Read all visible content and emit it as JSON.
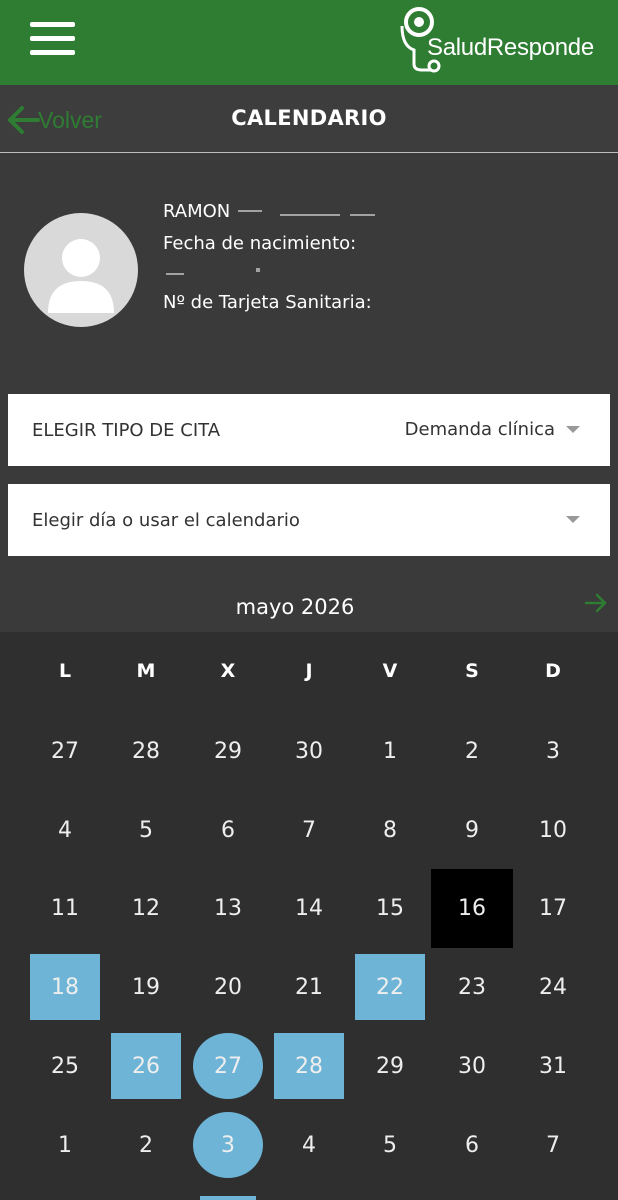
{
  "header": {
    "menu_icon": "hamburger-menu-icon",
    "logo_text": "SaludResponde",
    "logo_icon": "stethoscope-icon"
  },
  "nav": {
    "back_label": "Volver",
    "title": "CALENDARIO"
  },
  "patient": {
    "name": "RAMON",
    "dob_label": "Fecha de nacimiento:",
    "card_label": "Nº de Tarjeta Sanitaria:"
  },
  "appointment_type": {
    "label": "ELEGIR TIPO DE CITA",
    "value": "Demanda clínica"
  },
  "day_picker": {
    "label": "Elegir día o usar el calendario"
  },
  "calendar": {
    "month_label": "mayo 2026",
    "weekdays": [
      "L",
      "M",
      "X",
      "J",
      "V",
      "S",
      "D"
    ],
    "colors": {
      "available": "#6eb4d6",
      "today": "#000000",
      "brand_green": "#2e7d32"
    },
    "weeks": [
      [
        {
          "d": "27"
        },
        {
          "d": "28"
        },
        {
          "d": "29"
        },
        {
          "d": "30"
        },
        {
          "d": "1"
        },
        {
          "d": "2"
        },
        {
          "d": "3"
        }
      ],
      [
        {
          "d": "4"
        },
        {
          "d": "5"
        },
        {
          "d": "6"
        },
        {
          "d": "7"
        },
        {
          "d": "8"
        },
        {
          "d": "9"
        },
        {
          "d": "10"
        }
      ],
      [
        {
          "d": "11"
        },
        {
          "d": "12"
        },
        {
          "d": "13"
        },
        {
          "d": "14"
        },
        {
          "d": "15"
        },
        {
          "d": "16",
          "state": "today"
        },
        {
          "d": "17"
        }
      ],
      [
        {
          "d": "18",
          "state": "available"
        },
        {
          "d": "19"
        },
        {
          "d": "20"
        },
        {
          "d": "21"
        },
        {
          "d": "22",
          "state": "available"
        },
        {
          "d": "23"
        },
        {
          "d": "24"
        }
      ],
      [
        {
          "d": "25"
        },
        {
          "d": "26",
          "state": "available"
        },
        {
          "d": "27",
          "state": "available-circle"
        },
        {
          "d": "28",
          "state": "available"
        },
        {
          "d": "29"
        },
        {
          "d": "30"
        },
        {
          "d": "31"
        }
      ],
      [
        {
          "d": "1"
        },
        {
          "d": "2"
        },
        {
          "d": "3",
          "state": "available-circle"
        },
        {
          "d": "4"
        },
        {
          "d": "5"
        },
        {
          "d": "6"
        },
        {
          "d": "7"
        }
      ]
    ]
  }
}
